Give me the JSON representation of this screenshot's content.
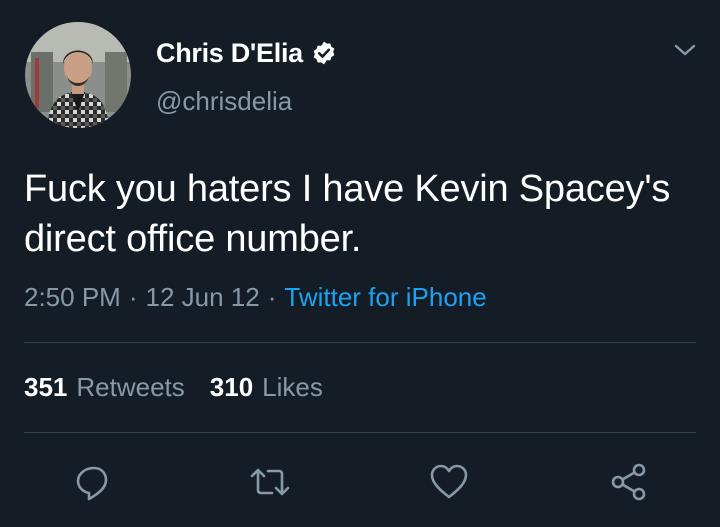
{
  "colors": {
    "background": "#141d26",
    "text": "#ffffff",
    "muted": "#8899a6",
    "accent": "#1da1f2",
    "divider": "#38444d"
  },
  "author": {
    "display_name": "Chris D'Elia",
    "handle": "@chrisdelia",
    "verified": true,
    "verified_icon": "verified-badge-icon",
    "avatar_icon": "profile-photo"
  },
  "tweet": {
    "text": "Fuck you haters I have Kevin Spacey's direct office number.",
    "time": "2:50 PM",
    "date": "12 Jun 12",
    "separator": "·",
    "source": "Twitter for iPhone"
  },
  "stats": {
    "retweets_count": "351",
    "retweets_label": "Retweets",
    "likes_count": "310",
    "likes_label": "Likes"
  },
  "actions": [
    {
      "name": "reply",
      "icon": "reply-icon"
    },
    {
      "name": "retweet",
      "icon": "retweet-icon"
    },
    {
      "name": "like",
      "icon": "heart-icon"
    },
    {
      "name": "share",
      "icon": "share-icon"
    }
  ],
  "menu_icon": "chevron-down-icon"
}
